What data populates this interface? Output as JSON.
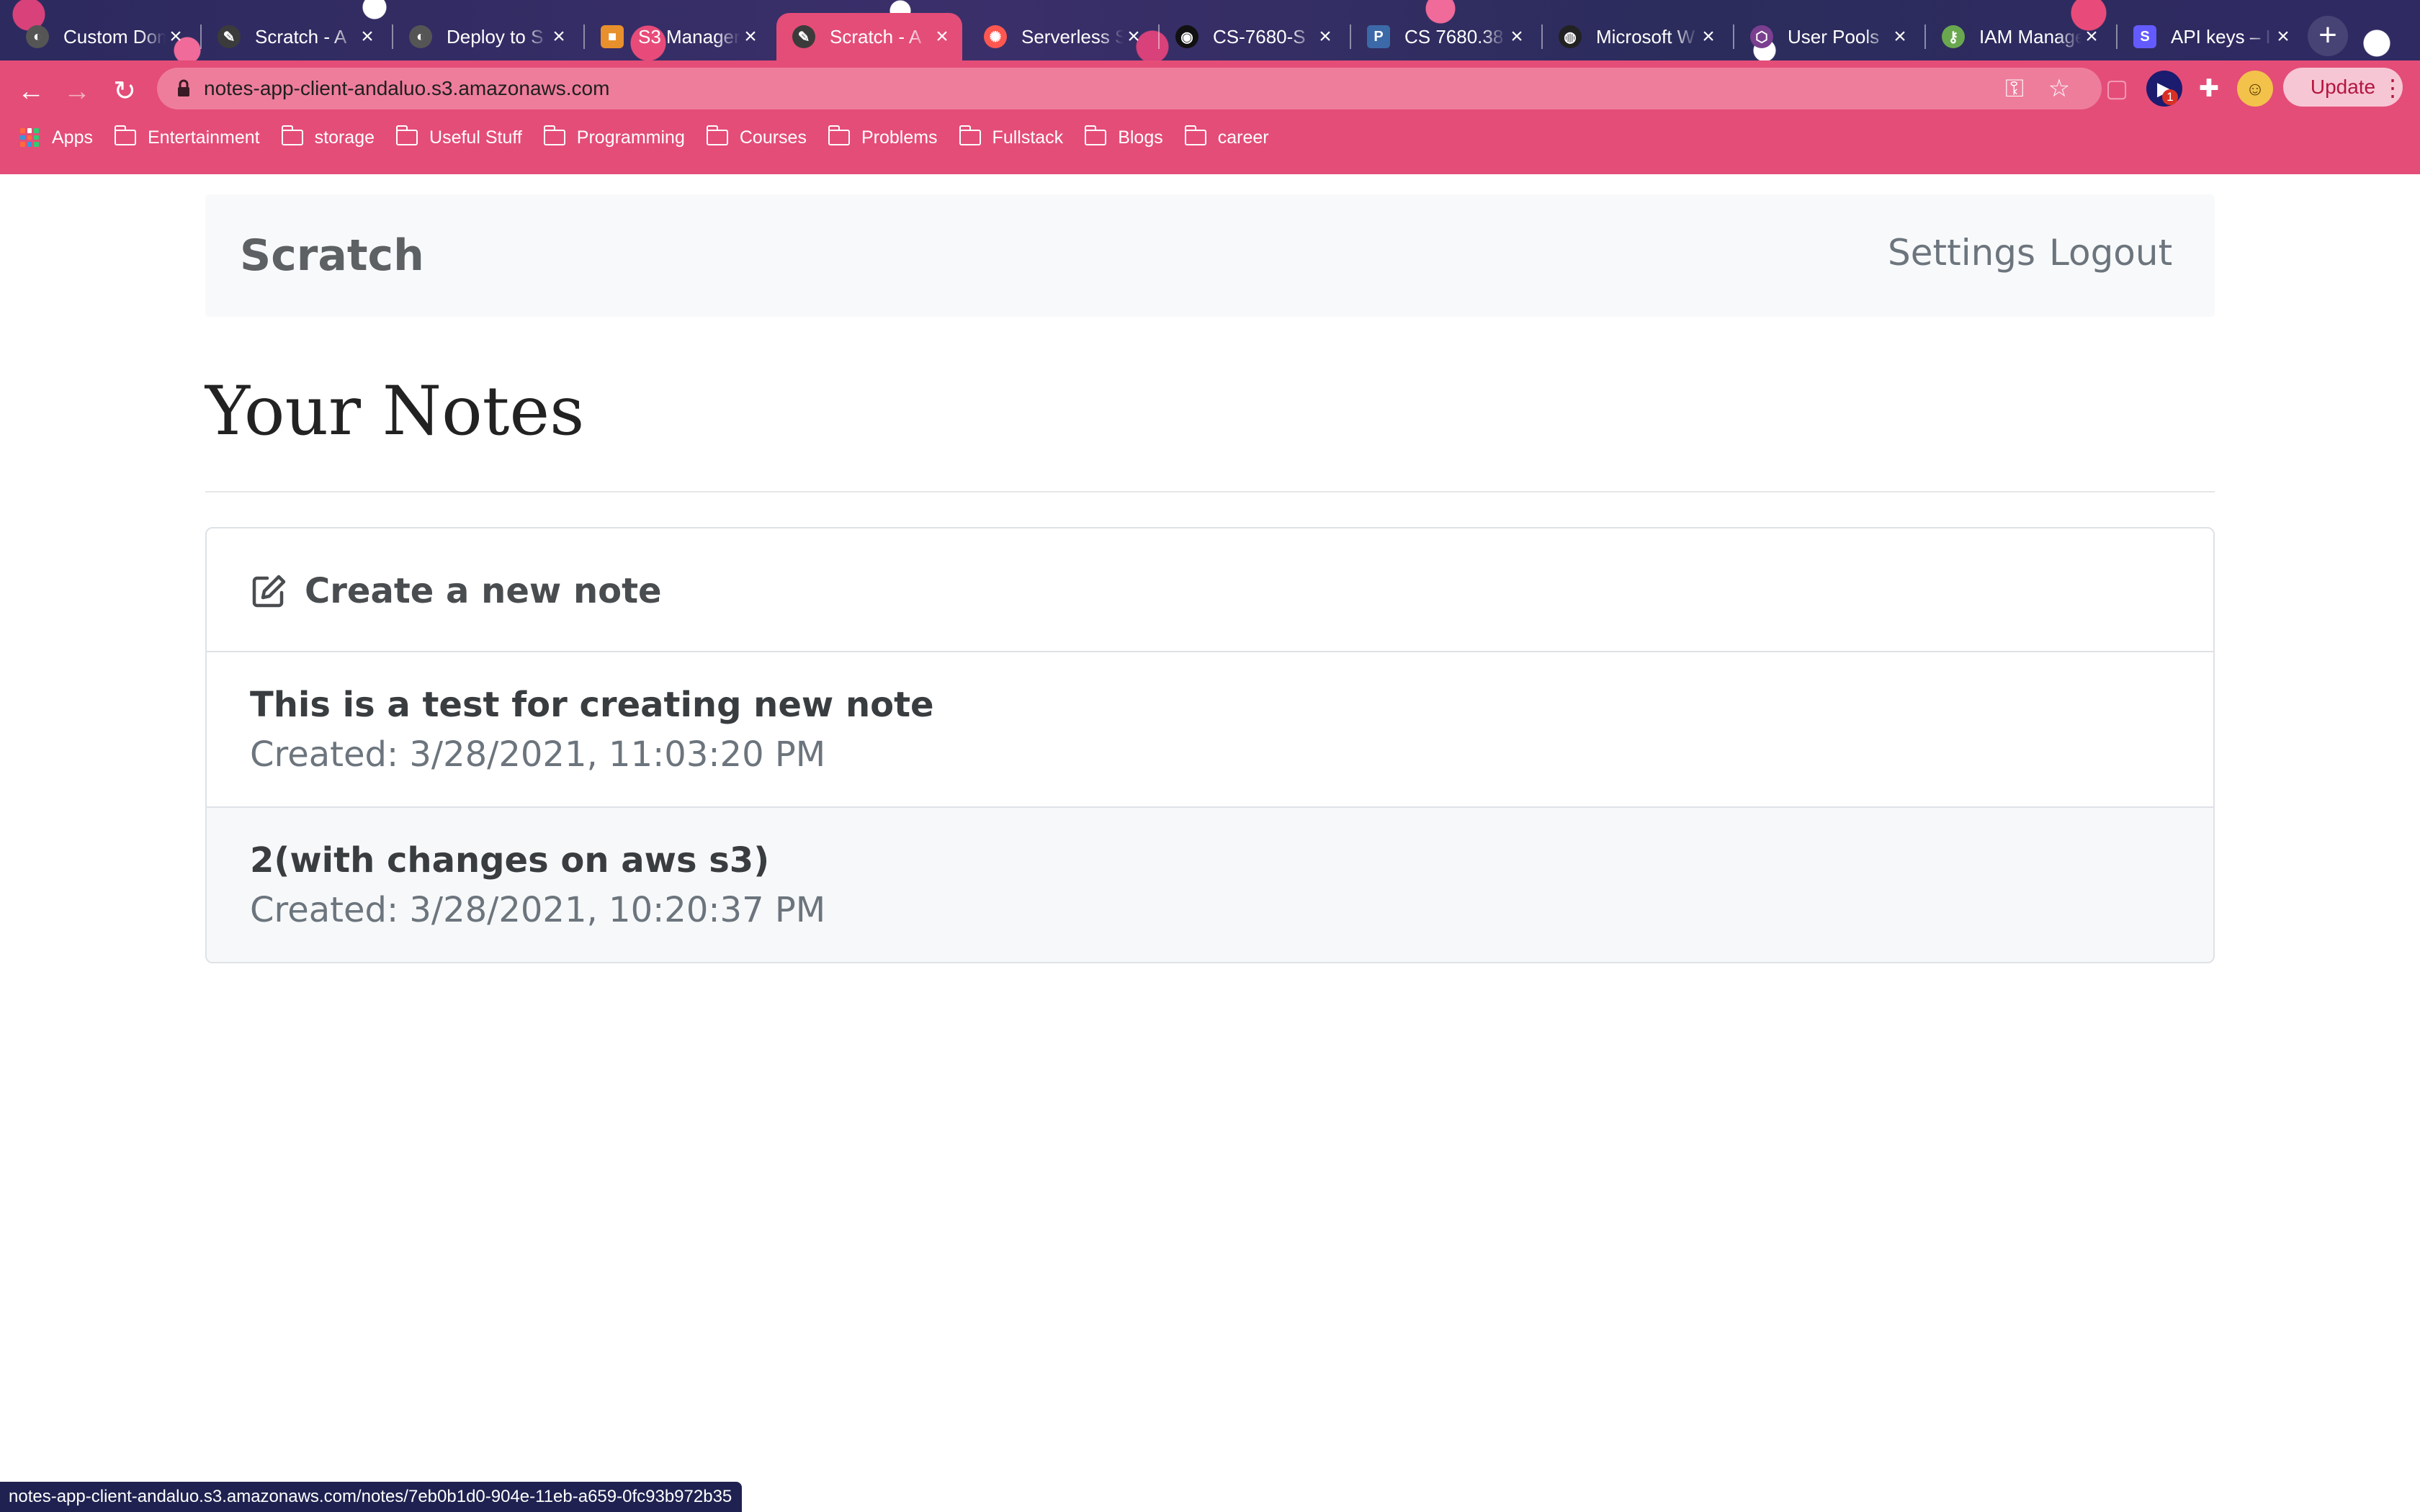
{
  "browser": {
    "tabs": [
      {
        "title": "Custom Dom",
        "favicon": "globe-dark-icon",
        "color": "#444"
      },
      {
        "title": "Scratch - A",
        "favicon": "pencil-icon",
        "color": "#555"
      },
      {
        "title": "Deploy to S",
        "favicon": "globe-dark-icon",
        "color": "#444"
      },
      {
        "title": "S3 Manager",
        "favicon": "aws-s3-icon",
        "color": "#e8902c"
      },
      {
        "title": "Scratch - A",
        "favicon": "pencil-icon",
        "color": "#555"
      },
      {
        "title": "Serverless S",
        "favicon": "serverless-icon",
        "color": "#fd5750"
      },
      {
        "title": "CS-7680-S",
        "favicon": "github-icon",
        "color": "#111"
      },
      {
        "title": "CS 7680.38",
        "favicon": "p-icon",
        "color": "#3c6aa8"
      },
      {
        "title": "Microsoft W",
        "favicon": "globe-icon",
        "color": "#222"
      },
      {
        "title": "User Pools",
        "favicon": "cognito-icon",
        "color": "#7a3f8f"
      },
      {
        "title": "IAM Manage",
        "favicon": "iam-icon",
        "color": "#6aa84f"
      },
      {
        "title": "API keys – I",
        "favicon": "stripe-s-icon",
        "color": "#635bff"
      }
    ],
    "active_tab_index": 4,
    "url": "notes-app-client-andaluo.s3.amazonaws.com",
    "update_label": "Update",
    "extension_badge": "1",
    "bookmarks": [
      {
        "label": "Apps",
        "icon": "apps-grid-icon"
      },
      {
        "label": "Entertainment",
        "icon": "folder-icon"
      },
      {
        "label": "storage",
        "icon": "folder-icon"
      },
      {
        "label": "Useful Stuff",
        "icon": "folder-icon"
      },
      {
        "label": "Programming",
        "icon": "folder-icon"
      },
      {
        "label": "Courses",
        "icon": "folder-icon"
      },
      {
        "label": "Problems",
        "icon": "folder-icon"
      },
      {
        "label": "Fullstack",
        "icon": "folder-icon"
      },
      {
        "label": "Blogs",
        "icon": "folder-icon"
      },
      {
        "label": "career",
        "icon": "folder-icon"
      }
    ],
    "status_url": "notes-app-client-andaluo.s3.amazonaws.com/notes/7eb0b1d0-904e-11eb-a659-0fc93b972b35",
    "colors": {
      "toolbar": "#e44d78",
      "active_tab": "#e44d78"
    }
  },
  "app": {
    "brand": "Scratch",
    "nav": {
      "settings": "Settings",
      "logout": "Logout"
    },
    "page_title": "Your Notes",
    "create_label": "Create a new note",
    "notes": [
      {
        "title": "This is a test for creating new note",
        "created": "Created: 3/28/2021, 11:03:20 PM"
      },
      {
        "title": "2(with changes on aws s3)",
        "created": "Created: 3/28/2021, 10:20:37 PM"
      }
    ]
  }
}
